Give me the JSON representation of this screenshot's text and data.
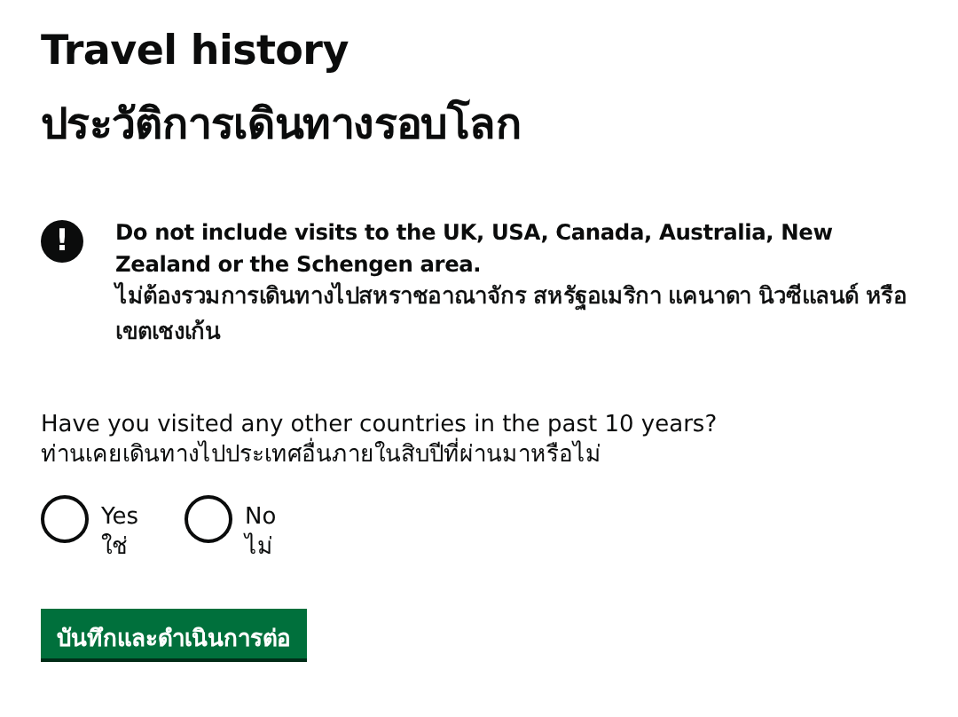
{
  "heading": {
    "title": "Travel history",
    "subtitle": "ประวัติการเดินทางรอบโลก"
  },
  "warning": {
    "icon": "!",
    "text": "Do not include visits to the UK, USA, Canada, Australia, New Zealand or the Schengen area.",
    "translation": "ไม่ต้องรวมการเดินทางไปสหราชอาณาจักร สหรัฐอเมริกา แคนาดา นิวซีแลนด์ หรือเขตเชงเก้น"
  },
  "question": {
    "label": "Have you visited any other countries in the past 10 years?",
    "translation": "ท่านเคยเดินทางไปประเทศอื่นภายในสิบปีที่ผ่านมาหรือไม่",
    "options": [
      {
        "label": "Yes",
        "translation": "ใช่",
        "selected": false
      },
      {
        "label": "No",
        "translation": "ไม่",
        "selected": false
      }
    ]
  },
  "button": {
    "label": "บันทึกและดำเนินการต่อ"
  }
}
